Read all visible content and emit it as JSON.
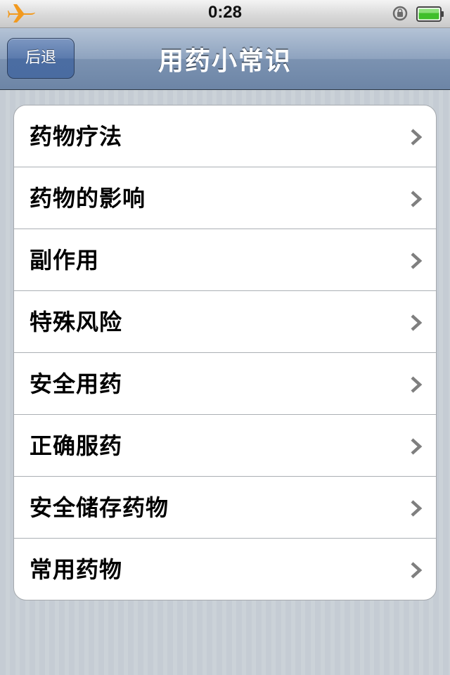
{
  "status_bar": {
    "time": "0:28",
    "icons": [
      "airplane-icon",
      "orientation-lock-icon",
      "battery-icon"
    ],
    "airplane_color": "#f29a1f",
    "battery_color": "#3fbf2b"
  },
  "nav_bar": {
    "back_label": "后退",
    "title": "用药小常识"
  },
  "menu": {
    "items": [
      {
        "label": "药物疗法"
      },
      {
        "label": "药物的影响"
      },
      {
        "label": "副作用"
      },
      {
        "label": "特殊风险"
      },
      {
        "label": "安全用药"
      },
      {
        "label": "正确服药"
      },
      {
        "label": "安全储存药物"
      },
      {
        "label": "常用药物"
      }
    ],
    "disclosure_icon": "chevron-right-icon"
  }
}
